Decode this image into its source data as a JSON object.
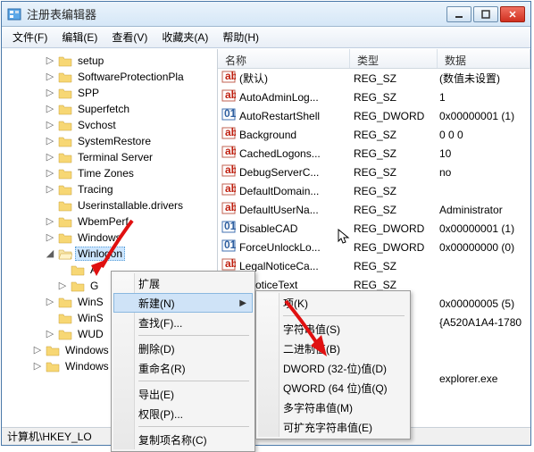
{
  "window": {
    "title": "注册表编辑器"
  },
  "menu": {
    "file": "文件(F)",
    "edit": "编辑(E)",
    "view": "查看(V)",
    "fav": "收藏夹(A)",
    "help": "帮助(H)"
  },
  "tree": {
    "items": [
      {
        "d": 3,
        "t": "▷",
        "l": "setup"
      },
      {
        "d": 3,
        "t": "▷",
        "l": "SoftwareProtectionPla"
      },
      {
        "d": 3,
        "t": "▷",
        "l": "SPP"
      },
      {
        "d": 3,
        "t": "▷",
        "l": "Superfetch"
      },
      {
        "d": 3,
        "t": "▷",
        "l": "Svchost"
      },
      {
        "d": 3,
        "t": "▷",
        "l": "SystemRestore"
      },
      {
        "d": 3,
        "t": "▷",
        "l": "Terminal Server"
      },
      {
        "d": 3,
        "t": "▷",
        "l": "Time Zones"
      },
      {
        "d": 3,
        "t": "▷",
        "l": "Tracing"
      },
      {
        "d": 3,
        "t": "",
        "l": "Userinstallable.drivers"
      },
      {
        "d": 3,
        "t": "▷",
        "l": "WbemPerf"
      },
      {
        "d": 3,
        "t": "▷",
        "l": "Windows"
      },
      {
        "d": 3,
        "t": "◢",
        "l": "Winlogon",
        "sel": true,
        "open": true
      },
      {
        "d": 4,
        "t": "",
        "l": "A"
      },
      {
        "d": 4,
        "t": "▷",
        "l": "G"
      },
      {
        "d": 3,
        "t": "▷",
        "l": "WinS"
      },
      {
        "d": 3,
        "t": "",
        "l": "WinS"
      },
      {
        "d": 3,
        "t": "▷",
        "l": "WUD"
      },
      {
        "d": 2,
        "t": "▷",
        "l": "Windows P"
      },
      {
        "d": 2,
        "t": "▷",
        "l": "Windows P"
      }
    ]
  },
  "list": {
    "cols": {
      "name": "名称",
      "type": "类型",
      "data": "数据"
    },
    "rows": [
      {
        "i": "sz",
        "n": "(默认)",
        "t": "REG_SZ",
        "d": "(数值未设置)"
      },
      {
        "i": "sz",
        "n": "AutoAdminLog...",
        "t": "REG_SZ",
        "d": "1"
      },
      {
        "i": "dw",
        "n": "AutoRestartShell",
        "t": "REG_DWORD",
        "d": "0x00000001 (1)"
      },
      {
        "i": "sz",
        "n": "Background",
        "t": "REG_SZ",
        "d": "0 0 0"
      },
      {
        "i": "sz",
        "n": "CachedLogons...",
        "t": "REG_SZ",
        "d": "10"
      },
      {
        "i": "sz",
        "n": "DebugServerC...",
        "t": "REG_SZ",
        "d": "no"
      },
      {
        "i": "sz",
        "n": "DefaultDomain...",
        "t": "REG_SZ",
        "d": ""
      },
      {
        "i": "sz",
        "n": "DefaultUserNa...",
        "t": "REG_SZ",
        "d": "Administrator"
      },
      {
        "i": "dw",
        "n": "DisableCAD",
        "t": "REG_DWORD",
        "d": "0x00000001 (1)"
      },
      {
        "i": "dw",
        "n": "ForceUnlockLo...",
        "t": "REG_DWORD",
        "d": "0x00000000 (0)"
      },
      {
        "i": "sz",
        "n": "LegalNoticeCa...",
        "t": "REG_SZ",
        "d": ""
      },
      {
        "i": "sz",
        "n": "alNoticeText",
        "t": "REG_SZ",
        "d": ""
      }
    ],
    "extra": [
      {
        "d": "0x00000005 (5)"
      },
      {
        "d": "{A520A1A4-1780"
      },
      {
        "d": ""
      },
      {
        "d": ""
      },
      {
        "d": "explorer.exe"
      }
    ]
  },
  "ctx1": {
    "expand": "扩展",
    "new": "新建(N)",
    "find": "查找(F)...",
    "delete": "删除(D)",
    "rename": "重命名(R)",
    "export": "导出(E)",
    "perm": "权限(P)...",
    "copy": "复制项名称(C)"
  },
  "ctx2": {
    "key": "项(K)",
    "sz": "字符串值(S)",
    "bin": "二进制值(B)",
    "dword": "DWORD (32-位)值(D)",
    "qword": "QWORD (64 位)值(Q)",
    "multi": "多字符串值(M)",
    "expand": "可扩充字符串值(E)"
  },
  "status": {
    "path": "计算机\\HKEY_LO"
  }
}
